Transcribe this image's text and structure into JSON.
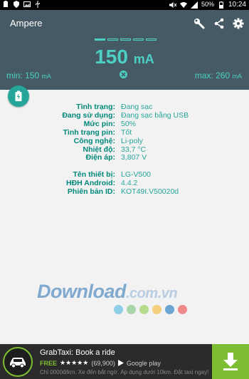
{
  "statusbar": {
    "battery_pct": "50%",
    "time": "10:24"
  },
  "appbar": {
    "title": "Ampere"
  },
  "meter": {
    "current_value": "150",
    "current_unit": "mA",
    "min_label": "min:",
    "min_value": "150",
    "max_label": "max:",
    "max_value": "260",
    "unit": "mA"
  },
  "info": {
    "status": [
      {
        "key": "Tình trạng:",
        "value": "Đang sạc"
      },
      {
        "key": "Đang sử dụng:",
        "value": "Đang sạc bằng USB"
      },
      {
        "key": "Mức pin:",
        "value": "50%"
      },
      {
        "key": "Tình trạng pin:",
        "value": "Tốt"
      },
      {
        "key": "Công nghệ:",
        "value": "Li-poly"
      },
      {
        "key": "Nhiệt độ:",
        "value": "33,7 °C"
      },
      {
        "key": "Điện áp:",
        "value": "3,807 V"
      }
    ],
    "device": [
      {
        "key": "Tên thiết bị:",
        "value": "LG-V500"
      },
      {
        "key": "HĐH Android:",
        "value": "4.4.2"
      },
      {
        "key": "Phiên bản ID:",
        "value": "KOT49I.V50020d"
      }
    ]
  },
  "watermark": {
    "main": "Download",
    "suffix": ".com.vn",
    "dot_colors": [
      "#8ecfe8",
      "#a9d6a9",
      "#b6dc8e",
      "#f4cf7e",
      "#6aa5d4",
      "#ef8a8a"
    ]
  },
  "ad": {
    "title": "GrabTaxi: Book a ride",
    "price": "FREE",
    "stars": "★★★★★",
    "rating_count": "(69,900)",
    "store": "Google play",
    "description": "Chỉ 0000đ/km. Xe đến bắt ngờ. Áp dụng dưới 10km. Đặt taxi ngay!"
  },
  "colors": {
    "appbar": "#455a64",
    "accent": "#4dd0c4",
    "label": "#00897b",
    "ad_green": "#7dbd31"
  }
}
